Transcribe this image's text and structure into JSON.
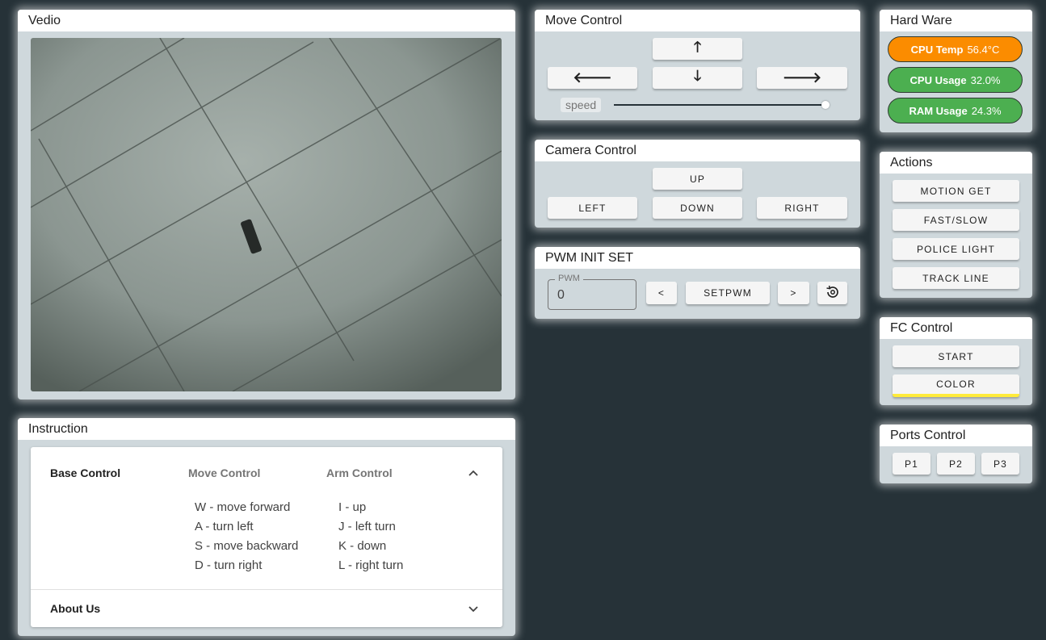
{
  "video": {
    "title": "Vedio"
  },
  "move_control": {
    "title": "Move Control",
    "up_icon": "arrow-up-icon",
    "left_icon": "arrow-left-icon",
    "down_icon": "arrow-down-icon",
    "right_icon": "arrow-right-icon",
    "speed_label": "speed",
    "speed_value": 1.0
  },
  "camera_control": {
    "title": "Camera Control",
    "up": "UP",
    "left": "LEFT",
    "down": "DOWN",
    "right": "RIGHT"
  },
  "pwm": {
    "title": "PWM INIT SET",
    "field_label": "PWM",
    "field_value": "0",
    "dec": "<",
    "set": "SETPWM",
    "inc": ">",
    "reset_icon": "settings-restore-icon"
  },
  "hardware": {
    "title": "Hard Ware",
    "items": [
      {
        "label": "CPU Temp",
        "value": "56.4°C",
        "color": "#fb8c00"
      },
      {
        "label": "CPU Usage",
        "value": "32.0%",
        "color": "#4caf50"
      },
      {
        "label": "RAM Usage",
        "value": "24.3%",
        "color": "#4caf50"
      }
    ]
  },
  "actions": {
    "title": "Actions",
    "buttons": [
      "MOTION GET",
      "FAST/SLOW",
      "POLICE LIGHT",
      "TRACK LINE"
    ]
  },
  "fc_control": {
    "title": "FC Control",
    "start": "START",
    "color": "COLOR",
    "color_bar": "#ffeb3b"
  },
  "ports_control": {
    "title": "Ports Control",
    "buttons": [
      "P1",
      "P2",
      "P3"
    ]
  },
  "instruction": {
    "title": "Instruction",
    "tabs": [
      "Base Control",
      "Move Control",
      "Arm Control"
    ],
    "move_keys": [
      "W - move forward",
      "A - turn left",
      "S - move backward",
      "D - turn right"
    ],
    "arm_keys": [
      "I - up",
      "J - left turn",
      "K - down",
      "L - right turn"
    ],
    "about": "About Us"
  }
}
